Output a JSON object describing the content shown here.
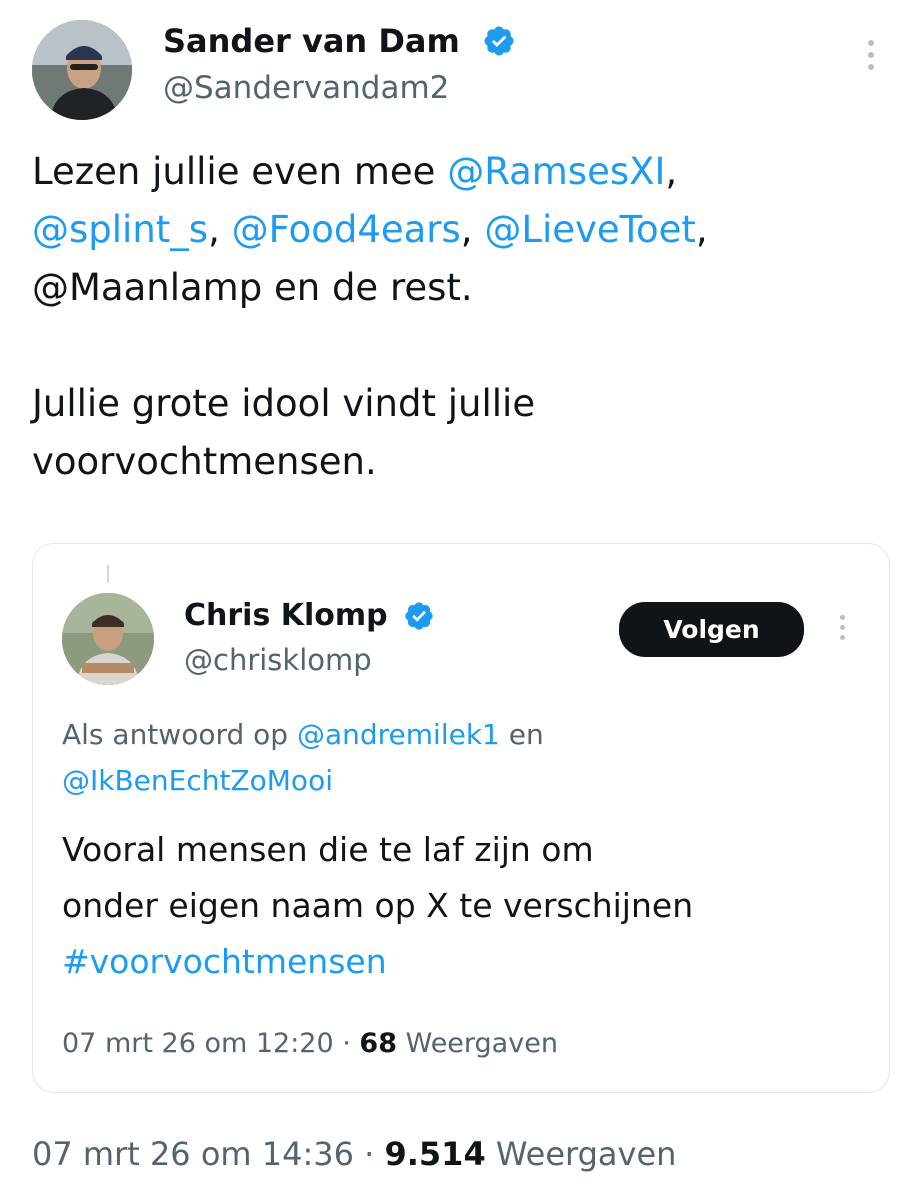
{
  "tweet": {
    "author_name": "Sander van Dam",
    "author_handle": "@Sandervandam2",
    "line1_text": "Lezen jullie even mee ",
    "line1_mention": "@RamsesXI",
    "line1_comma": ",",
    "line2_mention1": "@splint_s",
    "line2_sep1": ", ",
    "line2_mention2": "@Food4ears",
    "line2_sep2": ", ",
    "line2_mention3": "@LieveToet",
    "line2_comma": ",",
    "line3_text": "@Maanlamp en de rest.",
    "line4_text": "Jullie grote idool vindt jullie",
    "line5_text": "voorvochtmensen.",
    "timestamp": "07 mrt 26 om 14:36",
    "separator": " · ",
    "views_count": "9.514",
    "views_label": " Weergaven"
  },
  "quoted": {
    "author_name": "Chris Klomp",
    "author_handle": "@chrisklomp",
    "follow_label": "Volgen",
    "reply_prefix": "Als antwoord op ",
    "reply_mention1": "@andremilek1",
    "reply_and": " en",
    "reply_mention2": "@IkBenEchtZoMooi",
    "text_line1": "Vooral mensen die te laf zijn om",
    "text_line2": "onder eigen naam op X te verschijnen",
    "hashtag": "#voorvochtmensen",
    "timestamp": "07 mrt 26 om 12:20",
    "separator": " · ",
    "views_count": "68",
    "views_label": " Weergaven"
  },
  "colors": {
    "link": "#1d9bf0",
    "text": "#0f1419",
    "secondary": "#536471",
    "verified": "#1d9bf0",
    "button_bg": "#0f1419"
  },
  "icons": {
    "verified": "verified-badge-icon",
    "more": "more-vertical-icon"
  }
}
